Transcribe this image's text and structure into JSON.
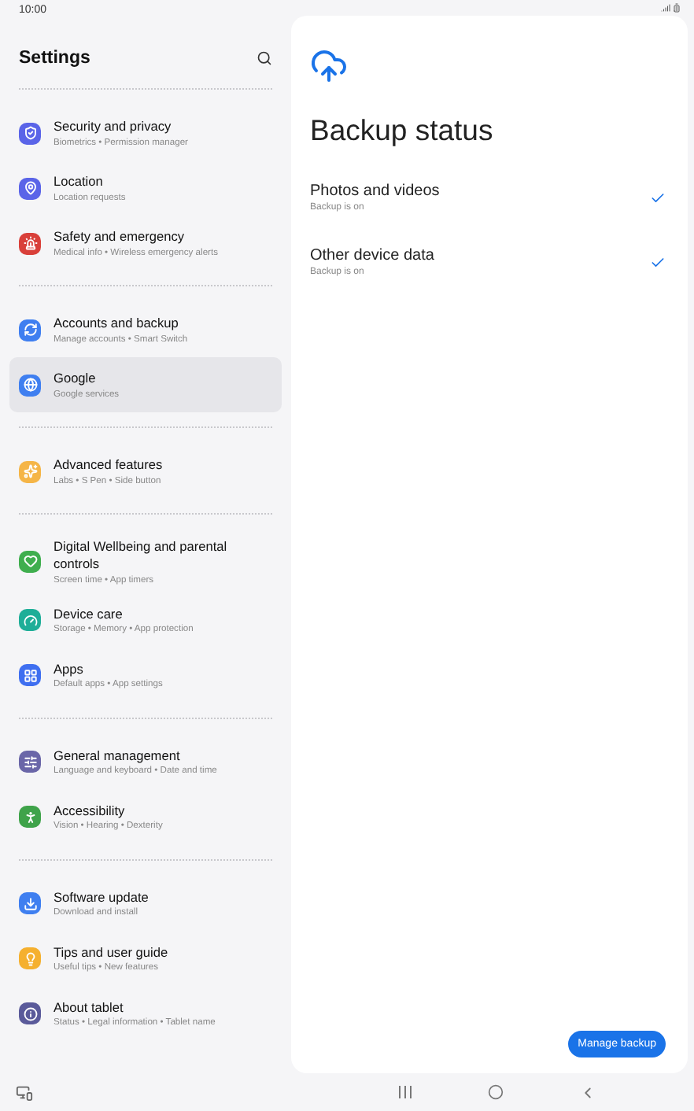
{
  "status_bar": {
    "time": "10:00"
  },
  "sidebar": {
    "title": "Settings",
    "groups": [
      {
        "items": [
          {
            "title": "Security and privacy",
            "subtitle": "Biometrics  •  Permission manager",
            "color": "#5a64e8",
            "selected": false
          },
          {
            "title": "Location",
            "subtitle": "Location requests",
            "color": "#5a64e8",
            "selected": false
          },
          {
            "title": "Safety and emergency",
            "subtitle": "Medical info  •  Wireless emergency alerts",
            "color": "#d9403a",
            "selected": false
          }
        ]
      },
      {
        "items": [
          {
            "title": "Accounts and backup",
            "subtitle": "Manage accounts  •  Smart Switch",
            "color": "#3f7ff0",
            "selected": false
          },
          {
            "title": "Google",
            "subtitle": "Google services",
            "color": "#3f7ff0",
            "selected": true
          }
        ]
      },
      {
        "items": [
          {
            "title": "Advanced features",
            "subtitle": "Labs  •  S Pen  •  Side button",
            "color": "#f5b547",
            "selected": false
          }
        ]
      },
      {
        "items": [
          {
            "title": "Digital Wellbeing and parental controls",
            "subtitle": "Screen time  •  App timers",
            "color": "#3fae4e",
            "selected": false
          },
          {
            "title": "Device care",
            "subtitle": "Storage  •  Memory  •  App protection",
            "color": "#1fae98",
            "selected": false
          },
          {
            "title": "Apps",
            "subtitle": "Default apps  •  App settings",
            "color": "#3f6ff0",
            "selected": false
          }
        ]
      },
      {
        "items": [
          {
            "title": "General management",
            "subtitle": "Language and keyboard  •  Date and time",
            "color": "#6a66a8",
            "selected": false
          },
          {
            "title": "Accessibility",
            "subtitle": "Vision  •  Hearing  •  Dexterity",
            "color": "#3fa34a",
            "selected": false
          }
        ]
      },
      {
        "items": [
          {
            "title": "Software update",
            "subtitle": "Download and install",
            "color": "#3f7ff0",
            "selected": false
          },
          {
            "title": "Tips and user guide",
            "subtitle": "Useful tips  •  New features",
            "color": "#f5b02f",
            "selected": false
          },
          {
            "title": "About tablet",
            "subtitle": "Status  •  Legal information  •  Tablet name",
            "color": "#5a5a9a",
            "selected": false
          }
        ]
      }
    ]
  },
  "detail": {
    "title": "Backup status",
    "rows": [
      {
        "title": "Photos and videos",
        "subtitle": "Backup is on",
        "checked": true
      },
      {
        "title": "Other device data",
        "subtitle": "Backup is on",
        "checked": true
      }
    ],
    "button": "Manage backup"
  }
}
